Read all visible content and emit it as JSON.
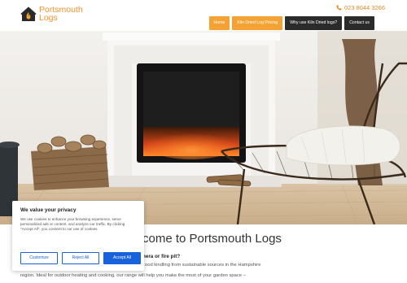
{
  "brand": {
    "name_line1": "Portsmouth",
    "name_line2": "Logs"
  },
  "header": {
    "phone": "023 8044 3266",
    "nav": [
      {
        "label": "Home"
      },
      {
        "label": "Kiln Dried Log Pricing"
      },
      {
        "label": "Why use Kiln Dried logs?"
      },
      {
        "label": "Contact us"
      }
    ]
  },
  "main": {
    "welcome_visible": "come to Portsmouth Logs",
    "question_visible": "hera or fire pit?",
    "para1_visible": "ood kindling from sustainable sources in the Hampshire",
    "para2_visible": "region. Ideal for outdoor heating and cooking, our range will help you make the most of your garden space –"
  },
  "cookie": {
    "title": "We value your privacy",
    "text": "We use cookies to enhance your browsing experience, serve personalized ads or content, and analyze our traffic. By clicking \"Accept All\", you consent to our use of cookies.",
    "customize": "Customize",
    "reject": "Reject All",
    "accept": "Accept All"
  },
  "colors": {
    "accent": "#f4a233",
    "cookie_blue": "#1863dc",
    "dark_nav": "#2b2b2b"
  }
}
